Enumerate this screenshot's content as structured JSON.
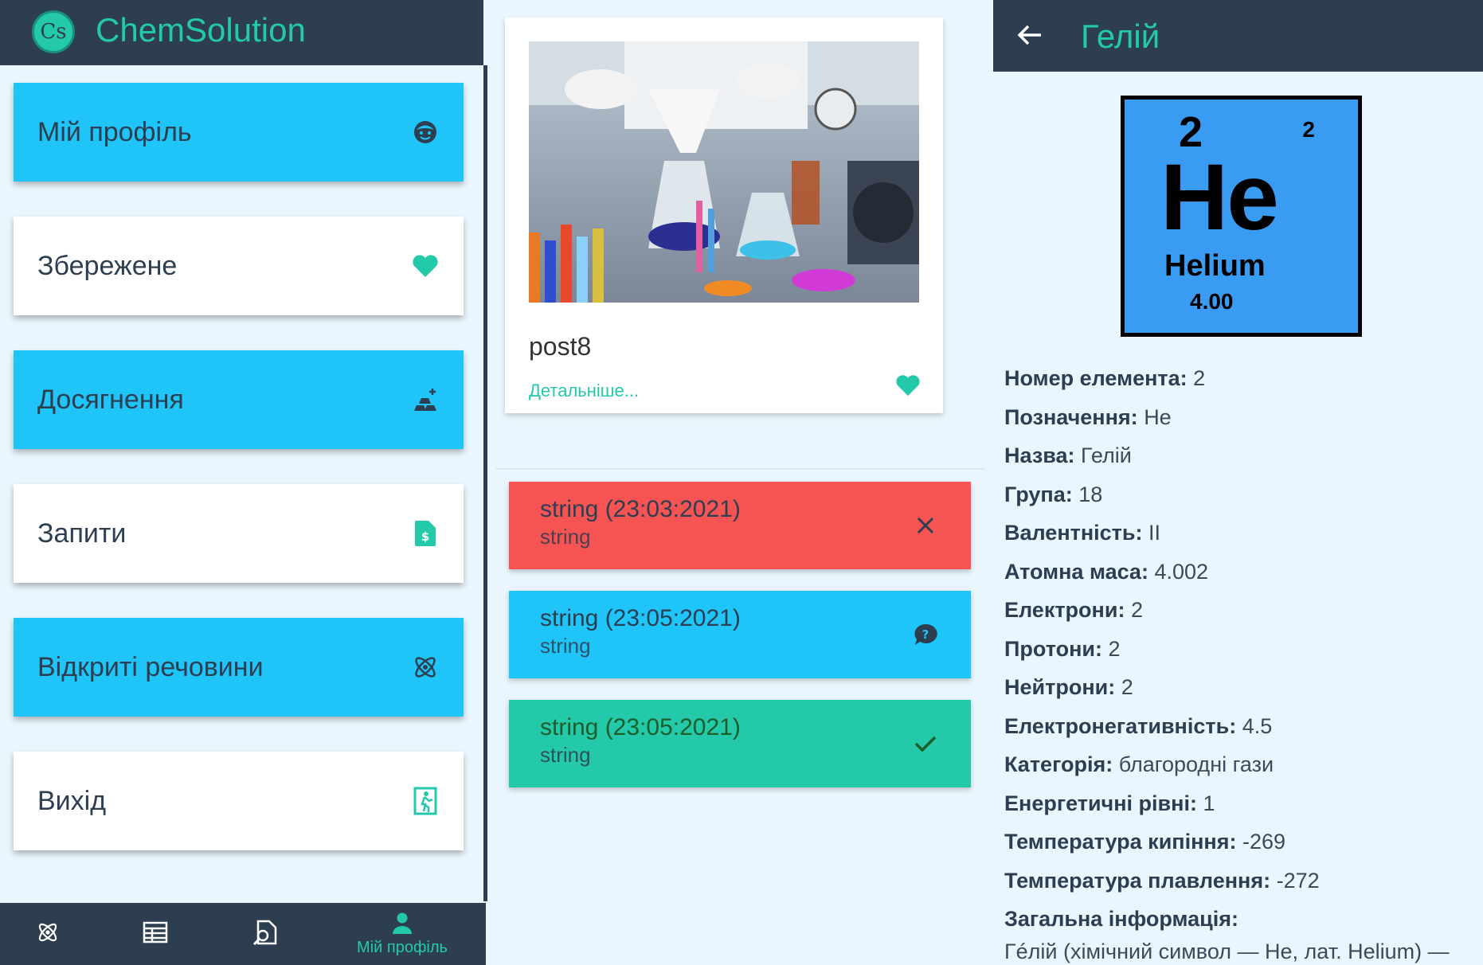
{
  "app": {
    "title": "ChemSolution",
    "logo_text": "Cs"
  },
  "menu": {
    "items": [
      {
        "label": "Мій профіль",
        "icon": "face-icon",
        "style": "blue"
      },
      {
        "label": "Збережене",
        "icon": "heart-icon",
        "style": "white"
      },
      {
        "label": "Досягнення",
        "icon": "gold-bars-icon",
        "style": "blue"
      },
      {
        "label": "Запити",
        "icon": "dollar-file-icon",
        "style": "white"
      },
      {
        "label": "Відкриті речовини",
        "icon": "atom-icon",
        "style": "blue"
      },
      {
        "label": "Вихід",
        "icon": "exit-door-icon",
        "style": "white"
      }
    ]
  },
  "bottom_nav": {
    "items": [
      {
        "icon": "atom-icon",
        "label": ""
      },
      {
        "icon": "table-icon",
        "label": ""
      },
      {
        "icon": "search-file-icon",
        "label": ""
      },
      {
        "icon": "profile-icon",
        "label": "Мій профіль",
        "active": true
      }
    ]
  },
  "post": {
    "title": "post8",
    "more_link": "Детальніше..."
  },
  "requests": [
    {
      "title": "string (23:03:2021)",
      "subtitle": "string",
      "status": "rejected",
      "color": "#f65452",
      "icon": "close-icon"
    },
    {
      "title": "string (23:05:2021)",
      "subtitle": "string",
      "status": "pending",
      "color": "#1fc4f8",
      "icon": "question-bubble-icon"
    },
    {
      "title": "string (23:05:2021)",
      "subtitle": "string",
      "status": "approved",
      "color": "#23c9a9",
      "icon": "check-icon"
    }
  ],
  "element": {
    "header_title": "Гелій",
    "tile": {
      "number": "2",
      "shell": "2",
      "symbol": "He",
      "name": "Helium",
      "mass": "4.00"
    },
    "properties": [
      {
        "key": "Номер елемента:",
        "value": "2"
      },
      {
        "key": "Позначення:",
        "value": "He"
      },
      {
        "key": "Назва:",
        "value": "Гелій"
      },
      {
        "key": "Група:",
        "value": "18"
      },
      {
        "key": "Валентність:",
        "value": "II"
      },
      {
        "key": "Атомна маса:",
        "value": "4.002"
      },
      {
        "key": "Електрони:",
        "value": "2"
      },
      {
        "key": "Протони:",
        "value": "2"
      },
      {
        "key": "Нейтрони:",
        "value": "2"
      },
      {
        "key": "Електронегативність:",
        "value": "4.5"
      },
      {
        "key": "Категорія:",
        "value": "благородні гази"
      },
      {
        "key": "Енергетичні рівні:",
        "value": "1"
      },
      {
        "key": "Температура кипіння:",
        "value": "-269"
      },
      {
        "key": "Температура плавлення:",
        "value": "-272"
      },
      {
        "key": "Загальна інформація:",
        "value": ""
      }
    ],
    "general_info": "Гéлій (хімічний символ — He, лат. Helium) —"
  },
  "colors": {
    "dark": "#2d3e50",
    "accent": "#23c9a9",
    "blue": "#1fc4f8",
    "red": "#f65452",
    "bg": "#eaf6fd"
  }
}
